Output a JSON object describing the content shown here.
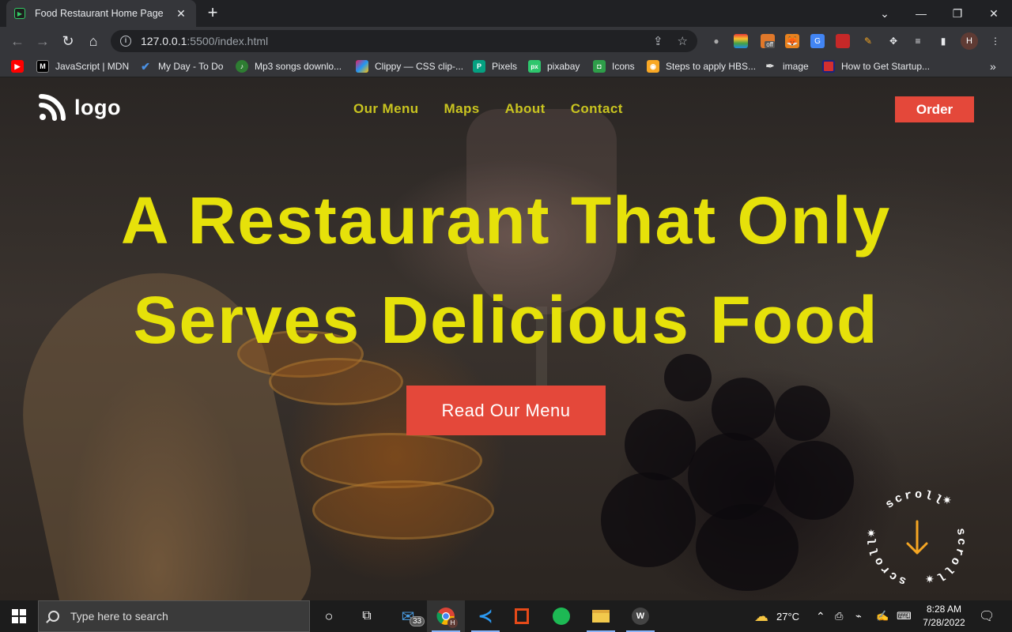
{
  "browser": {
    "tab_title": "Food Restaurant Home Page",
    "url_host": "127.0.0.1",
    "url_path": ":5500/index.html",
    "bookmarks": [
      {
        "label": "",
        "icon": "youtube-icon"
      },
      {
        "label": "JavaScript | MDN",
        "icon": "mdn-icon"
      },
      {
        "label": "My Day - To Do",
        "icon": "todo-icon"
      },
      {
        "label": "Mp3 songs downlo...",
        "icon": "music-icon"
      },
      {
        "label": "Clippy — CSS clip-...",
        "icon": "clippy-icon"
      },
      {
        "label": "Pixels",
        "icon": "pexels-icon"
      },
      {
        "label": "pixabay",
        "icon": "pixabay-icon"
      },
      {
        "label": "Icons",
        "icon": "icons-icon"
      },
      {
        "label": "Steps to apply HBS...",
        "icon": "steps-icon"
      },
      {
        "label": "image",
        "icon": "image-icon"
      },
      {
        "label": "How to Get Startup...",
        "icon": "startup-icon"
      }
    ],
    "ext_badge": "off",
    "avatar_letter": "H"
  },
  "site": {
    "logo_text": "logo",
    "nav": [
      "Our Menu",
      "Maps",
      "About",
      "Contact"
    ],
    "order_label": "Order",
    "hero_line1": "A Restaurant That Only",
    "hero_line2": "Serves Delicious Food",
    "cta_label": "Read Our Menu",
    "scroll_text": "scroll",
    "colors": {
      "accent_yellow": "#e6e10a",
      "nav_yellow": "#c9c420",
      "button_red": "#e4483a"
    }
  },
  "taskbar": {
    "search_placeholder": "Type here to search",
    "mail_badge": "33",
    "chrome_badge": "H",
    "weather": "27°C",
    "time": "8:28 AM",
    "date": "7/28/2022"
  }
}
